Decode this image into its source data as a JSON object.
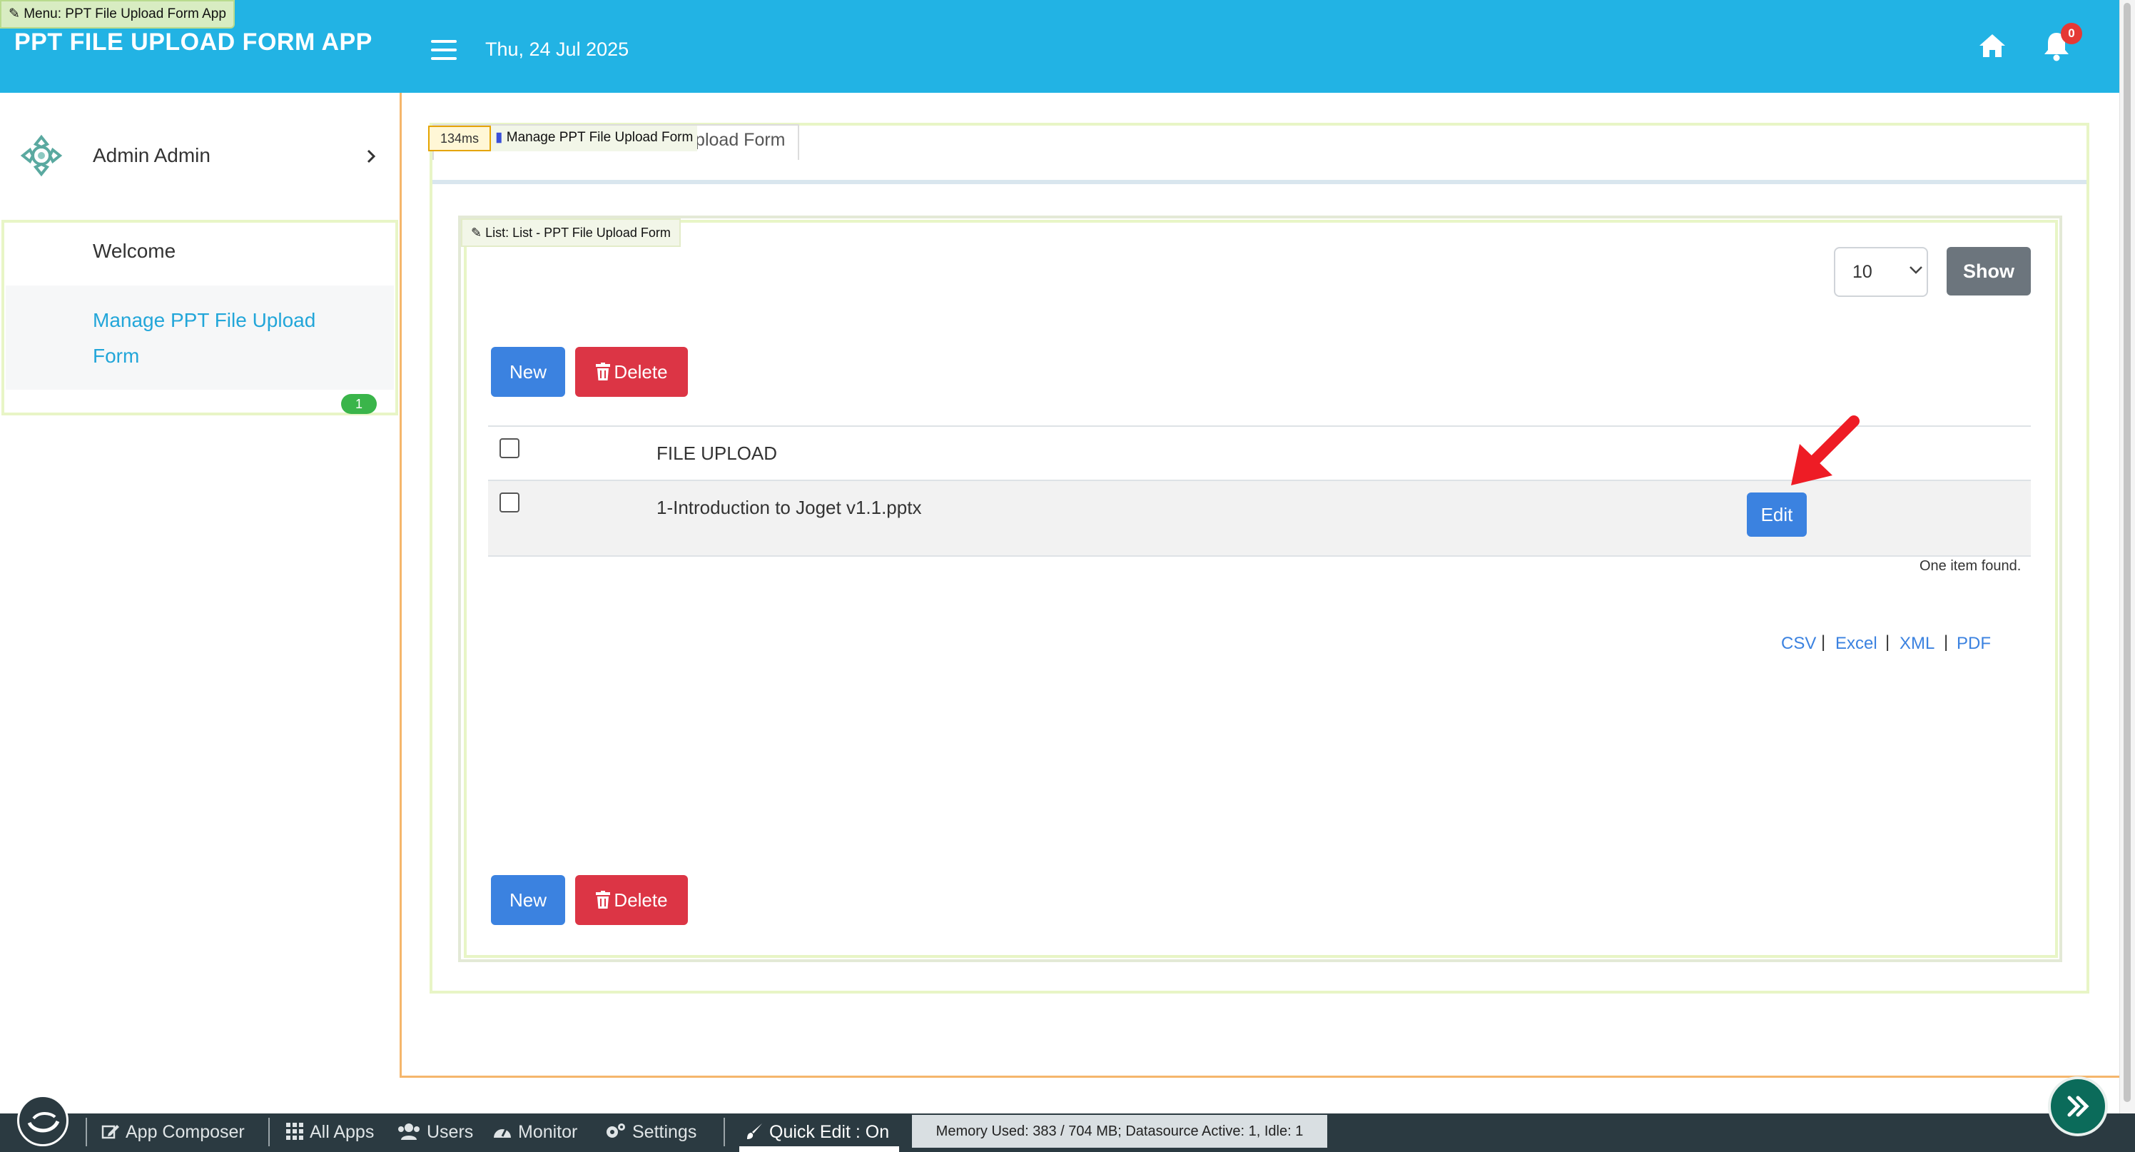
{
  "header": {
    "app_title": "PPT FILE UPLOAD FORM APP",
    "menu_tag": "Menu: PPT File Upload Form App",
    "date": "Thu, 24 Jul 2025",
    "notification_count": "0"
  },
  "sidebar": {
    "profile_name": "Admin Admin",
    "items": [
      {
        "label": "Welcome"
      },
      {
        "label": "Manage PPT File Upload Form",
        "badge": "1",
        "active": true
      }
    ]
  },
  "main": {
    "tab_label": "Upload Form",
    "timing": "134ms",
    "manage_tag": "Manage PPT File Upload Form",
    "list_tag": "List: List - PPT File Upload Form",
    "page_size": "10",
    "show_label": "Show",
    "new_label": "New",
    "delete_label": "Delete",
    "column_header": "FILE UPLOAD",
    "rows": [
      {
        "file": "1-Introduction to Joget v1.1.pptx",
        "edit_label": "Edit"
      }
    ],
    "items_found": "One item found.",
    "exports": [
      "CSV",
      "Excel",
      "XML",
      "PDF"
    ]
  },
  "bottom_bar": {
    "app_composer": "App Composer",
    "all_apps": "All Apps",
    "users": "Users",
    "monitor": "Monitor",
    "settings": "Settings",
    "quick_edit": "Quick Edit : On",
    "memory": "Memory Used: 383 / 704 MB; Datasource Active: 1, Idle: 1"
  },
  "colors": {
    "header": "#22b3e4",
    "primary": "#3b82e0",
    "danger": "#dc3545",
    "secondary": "#6c757d",
    "bottom_bar": "#2b3a41"
  }
}
